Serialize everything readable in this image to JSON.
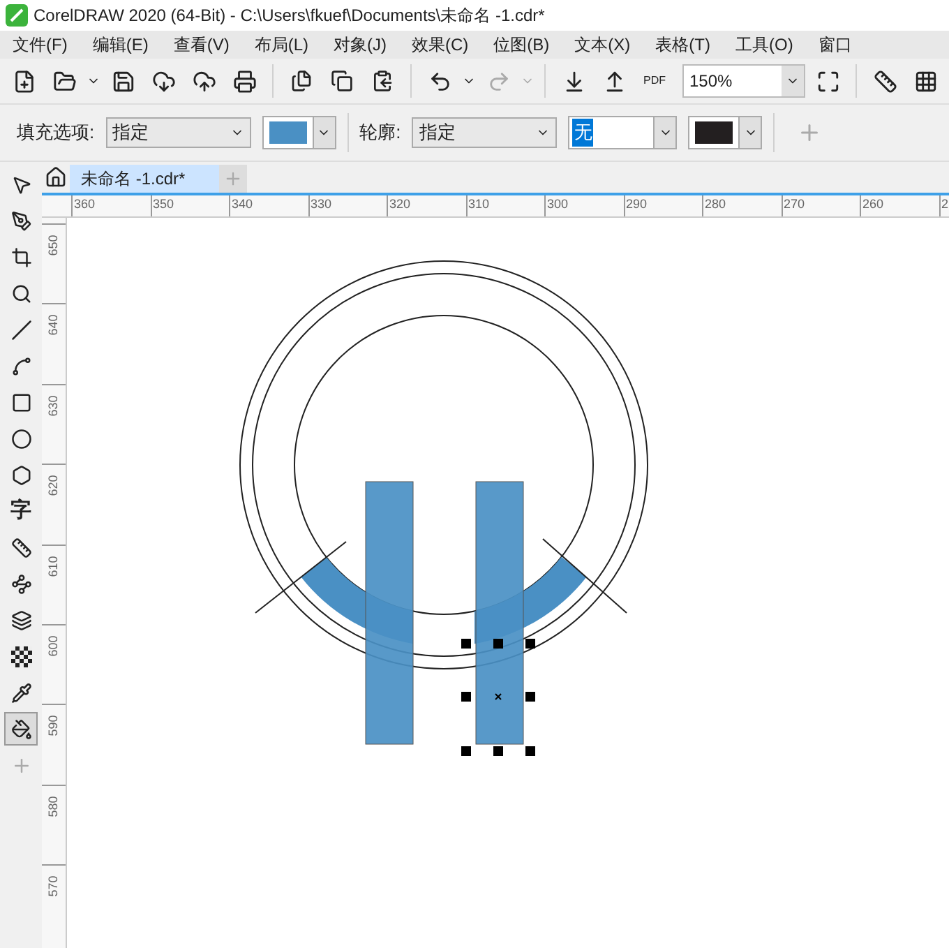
{
  "window": {
    "title": "CorelDRAW 2020 (64-Bit) - C:\\Users\\fkuef\\Documents\\未命名 -1.cdr*"
  },
  "menu": [
    "文件(F)",
    "编辑(E)",
    "查看(V)",
    "布局(L)",
    "对象(J)",
    "效果(C)",
    "位图(B)",
    "文本(X)",
    "表格(T)",
    "工具(O)",
    "窗口"
  ],
  "toolbar": {
    "pdf_label": "PDF",
    "zoom": "150%"
  },
  "property_bar": {
    "fill_label": "填充选项:",
    "fill_mode": "指定",
    "outline_label": "轮廓:",
    "outline_mode": "指定",
    "outline_width": "无"
  },
  "tabs": [
    {
      "label": "未命名 -1.cdr*",
      "selected": true
    }
  ],
  "ruler_h": [
    "360",
    "350",
    "340",
    "330",
    "320",
    "310",
    "300",
    "290",
    "280",
    "270",
    "260",
    "2"
  ],
  "ruler_v": [
    "650",
    "640",
    "630",
    "620",
    "610",
    "600",
    "590",
    "580",
    "570"
  ],
  "tools": [
    {
      "kind": "pick",
      "selected": false
    },
    {
      "kind": "shape",
      "selected": false
    },
    {
      "kind": "crop",
      "selected": false
    },
    {
      "kind": "zoom",
      "selected": false
    },
    {
      "kind": "line",
      "selected": false
    },
    {
      "kind": "curve",
      "selected": false
    },
    {
      "kind": "rect",
      "selected": false
    },
    {
      "kind": "ellipse",
      "selected": false
    },
    {
      "kind": "polygon",
      "selected": false
    },
    {
      "kind": "text",
      "glyph": "字",
      "selected": false
    },
    {
      "kind": "dimension",
      "selected": false
    },
    {
      "kind": "connector",
      "selected": false
    },
    {
      "kind": "shadow",
      "selected": false
    },
    {
      "kind": "transparency",
      "selected": false
    },
    {
      "kind": "eyedropper",
      "selected": false
    },
    {
      "kind": "fill",
      "selected": true
    },
    {
      "kind": "add",
      "selected": false
    }
  ]
}
